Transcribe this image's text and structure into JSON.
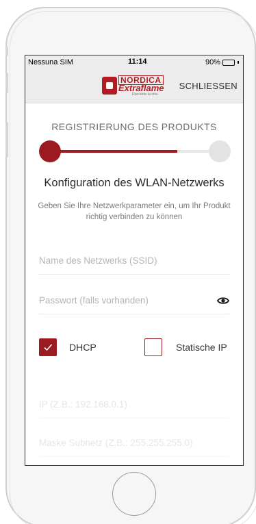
{
  "status_bar": {
    "carrier": "Nessuna SIM",
    "time": "11:14",
    "battery": "90%",
    "battery_level": 0.9
  },
  "navbar": {
    "logo": {
      "brand_top": "NORDICA",
      "brand_main": "Extraflame",
      "tagline": "Riscalda la vita."
    },
    "close_label": "SCHLIESSEN"
  },
  "wizard": {
    "step_title": "REGISTRIERUNG DES PRODUKTS",
    "progress": 0.75,
    "heading": "Konfiguration des WLAN-Netzwerks",
    "description": "Geben Sie Ihre Netzwerkparameter ein, um Ihr Produkt richtig verbinden zu können"
  },
  "form": {
    "ssid": {
      "value": "",
      "placeholder": "Name des Netzwerks (SSID)"
    },
    "password": {
      "value": "",
      "placeholder": "Passwort (falls vorhanden)",
      "toggle_icon": "eye-icon"
    },
    "dhcp": {
      "label": "DHCP",
      "checked": true
    },
    "static_ip": {
      "label": "Statische IP",
      "checked": false
    },
    "ip": {
      "value": "",
      "placeholder": "IP (Z.B.: 192.168.0.1)"
    },
    "subnet_mask": {
      "value": "",
      "placeholder": "Maske Subnetz (Z.B.: 255.255.255.0)"
    }
  },
  "colors": {
    "accent": "#9c1b22",
    "track_inactive": "#e6e6e6",
    "navbar_bg": "#ececec"
  }
}
